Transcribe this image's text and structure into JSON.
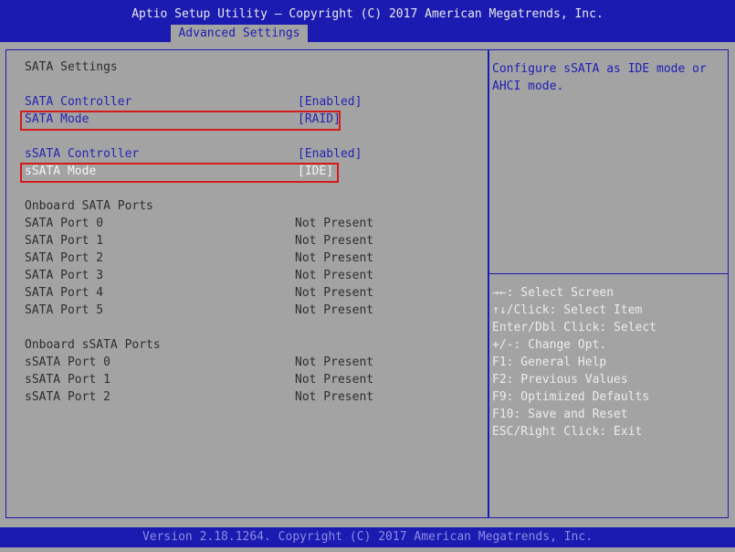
{
  "header": {
    "title": "Aptio Setup Utility – Copyright (C) 2017 American Megatrends, Inc.",
    "active_tab": "Advanced Settings"
  },
  "main": {
    "section_title": "SATA Settings",
    "sata_controller": {
      "label": "SATA Controller",
      "value": "[Enabled]"
    },
    "sata_mode": {
      "label": "SATA Mode",
      "value": "[RAID]"
    },
    "ssata_controller": {
      "label": "sSATA Controller",
      "value": "[Enabled]"
    },
    "ssata_mode": {
      "label": "sSATA Mode",
      "value": "[IDE]"
    },
    "onboard_sata_title": "Onboard SATA Ports",
    "sata_ports": [
      {
        "label": "SATA Port 0",
        "value": "Not Present"
      },
      {
        "label": "SATA Port 1",
        "value": "Not Present"
      },
      {
        "label": "SATA Port 2",
        "value": "Not Present"
      },
      {
        "label": "SATA Port 3",
        "value": "Not Present"
      },
      {
        "label": "SATA Port 4",
        "value": "Not Present"
      },
      {
        "label": "SATA Port 5",
        "value": "Not Present"
      }
    ],
    "onboard_ssata_title": "Onboard sSATA Ports",
    "ssata_ports": [
      {
        "label": "sSATA Port 0",
        "value": "Not Present"
      },
      {
        "label": "sSATA Port 1",
        "value": "Not Present"
      },
      {
        "label": "sSATA Port 2",
        "value": "Not Present"
      }
    ]
  },
  "help": {
    "text": "Configure sSATA as IDE mode or AHCI mode.",
    "keys": [
      "→←: Select Screen",
      "↑↓/Click: Select Item",
      "Enter/Dbl Click: Select",
      "+/-: Change Opt.",
      "F1: General Help",
      "F2: Previous Values",
      "F9: Optimized Defaults",
      "F10: Save and Reset",
      "ESC/Right Click: Exit"
    ]
  },
  "footer": {
    "text": "Version 2.18.1264. Copyright (C) 2017 American Megatrends, Inc."
  }
}
